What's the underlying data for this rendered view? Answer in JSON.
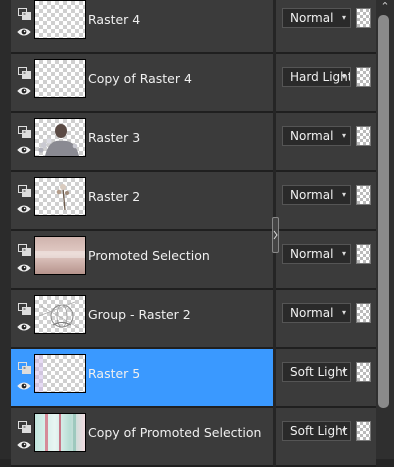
{
  "layers": [
    {
      "name": "Raster 4",
      "blend_mode": "Normal",
      "selected": false,
      "thumbnail": "transparent"
    },
    {
      "name": "Copy of Raster 4",
      "blend_mode": "Hard Light",
      "selected": false,
      "thumbnail": "transparent"
    },
    {
      "name": "Raster 3",
      "blend_mode": "Normal",
      "selected": false,
      "thumbnail": "woman-with-flowers"
    },
    {
      "name": "Raster 2",
      "blend_mode": "Normal",
      "selected": false,
      "thumbnail": "small-flower"
    },
    {
      "name": "Promoted Selection",
      "blend_mode": "Normal",
      "selected": false,
      "thumbnail": "pinkish-texture"
    },
    {
      "name": "Group - Raster 2",
      "blend_mode": "Normal",
      "selected": false,
      "thumbnail": "globe-sketch"
    },
    {
      "name": "Raster 5",
      "blend_mode": "Soft Light",
      "selected": true,
      "thumbnail": "faint-lavender"
    },
    {
      "name": "Copy of Promoted Selection",
      "blend_mode": "Soft Light",
      "selected": false,
      "thumbnail": "teal-curtains"
    }
  ],
  "icons": {
    "row_icon_top": "layer-link-icon",
    "row_icon_bottom": "visibility-eye-icon",
    "dropdown": "chevron-down-icon",
    "scroll": "scroll-up-arrow-icon"
  },
  "colors": {
    "panel_bg": "#3b3b3b",
    "selected_bg": "#3a99ff",
    "text": "#f0f0f0"
  }
}
